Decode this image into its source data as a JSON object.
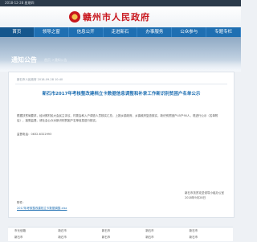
{
  "topbar": {
    "date": "2018-12-28 星期四"
  },
  "header": {
    "logo_text": "赣州市人民政府"
  },
  "nav": [
    {
      "label": "首页"
    },
    {
      "label": "领导之窗"
    },
    {
      "label": "信息公开"
    },
    {
      "label": "走进新石"
    },
    {
      "label": "办事服务"
    },
    {
      "label": "公众参与"
    },
    {
      "label": "专题专栏"
    }
  ],
  "banner": {
    "title": "通知公告",
    "breadcrumb": "首页 >通知公告"
  },
  "article": {
    "meta": "新石市人民政府    2018-09-28 10:40",
    "title": "新石市2017年考核整改建档立卡数据信息调整和补录工作新识别贫困户名单公示",
    "body": "根据扶贫局要求，经对照村民大会民主评议、村委会和入户调查人员核实汇总，上报乡镇政府、乡镇政府复查核实，新识别贫困户45户90人，现进行公示（名单附后），接受监督。请社会公众对新识别贫困户名单信息进行核实。",
    "phone": "监督电话：0632-6322993",
    "sign_org": "新石市扶贫攻坚领导小组办公室",
    "sign_date": "2018年9月28日",
    "attachment_label": "附件：",
    "attachment_link": "2017年考核整改建档立卡数据调整.xlsx"
  },
  "tabs": [
    "政府网站",
    "新闻",
    "学习网站"
  ],
  "footer_links": [
    "市长信箱",
    "新石市",
    "新石市",
    "新石市",
    "新石市",
    "新石市",
    "新石市",
    "新石市",
    "新石市",
    "新石市"
  ]
}
